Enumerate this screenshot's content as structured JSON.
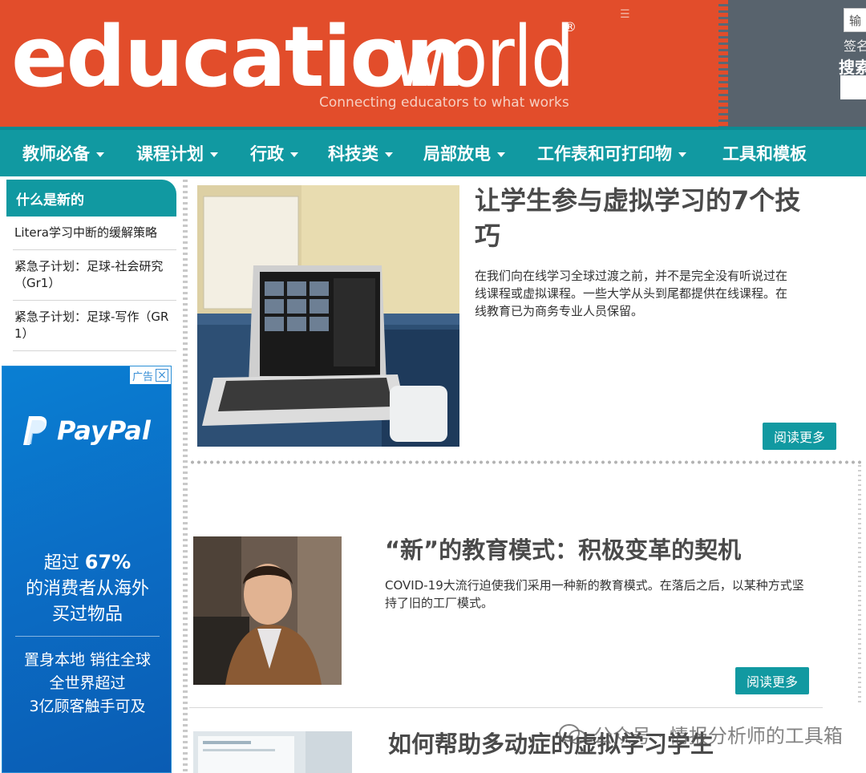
{
  "header": {
    "logo_education": "education",
    "logo_world": "world",
    "logo_reg": "®",
    "tagline": "Connecting educators to what works",
    "menu_icon": "☰",
    "search_input_value": "输入",
    "signin_text": "签名",
    "search_label": "搜索"
  },
  "nav": {
    "items": [
      {
        "label": "教师必备",
        "has_dropdown": true
      },
      {
        "label": "课程计划",
        "has_dropdown": true
      },
      {
        "label": "行政",
        "has_dropdown": true
      },
      {
        "label": "科技类",
        "has_dropdown": true
      },
      {
        "label": "局部放电",
        "has_dropdown": true
      },
      {
        "label": "工作表和可打印物",
        "has_dropdown": true
      },
      {
        "label": "工具和模板",
        "has_dropdown": false
      }
    ]
  },
  "sidebar": {
    "heading": "什么是新的",
    "items": [
      "Litera学习中断的缓解策略",
      "紧急子计划：足球-社会研究（Gr1）",
      "紧急子计划：足球-写作（GR 1）"
    ]
  },
  "ad": {
    "badge": "广告",
    "close_icon": "close-icon",
    "brand": "PayPal",
    "headline_1": "超过",
    "headline_pct": "67%",
    "headline_2": "的消费者从海外",
    "headline_3": "买过物品",
    "sub_1": "置身本地 销往全球",
    "sub_2": "全世界超过",
    "sub_3": "3亿顾客触手可及"
  },
  "articles": [
    {
      "title": "让学生参与虚拟学习的7个技巧",
      "excerpt": "在我们向在线学习全球过渡之前，并不是完全没有听说过在线课程或虚拟课程。一些大学从头到尾都提供在线课程。在线教育已为商务专业人员保留。",
      "read_more": "阅读更多"
    },
    {
      "title": "“新”的教育模式：积极变革的契机",
      "excerpt": "COVID-19大流行迫使我们采用一种新的教育模式。在落后之后，以某种方式坚持了旧的工厂模式。",
      "read_more": "阅读更多"
    },
    {
      "title": "如何帮助多动症的虚拟学习学生"
    }
  ],
  "watermark": "公众号 · 情报分析师的工具箱",
  "colors": {
    "brand_orange": "#e24d2b",
    "teal": "#1199a1",
    "slate": "#58636d"
  }
}
